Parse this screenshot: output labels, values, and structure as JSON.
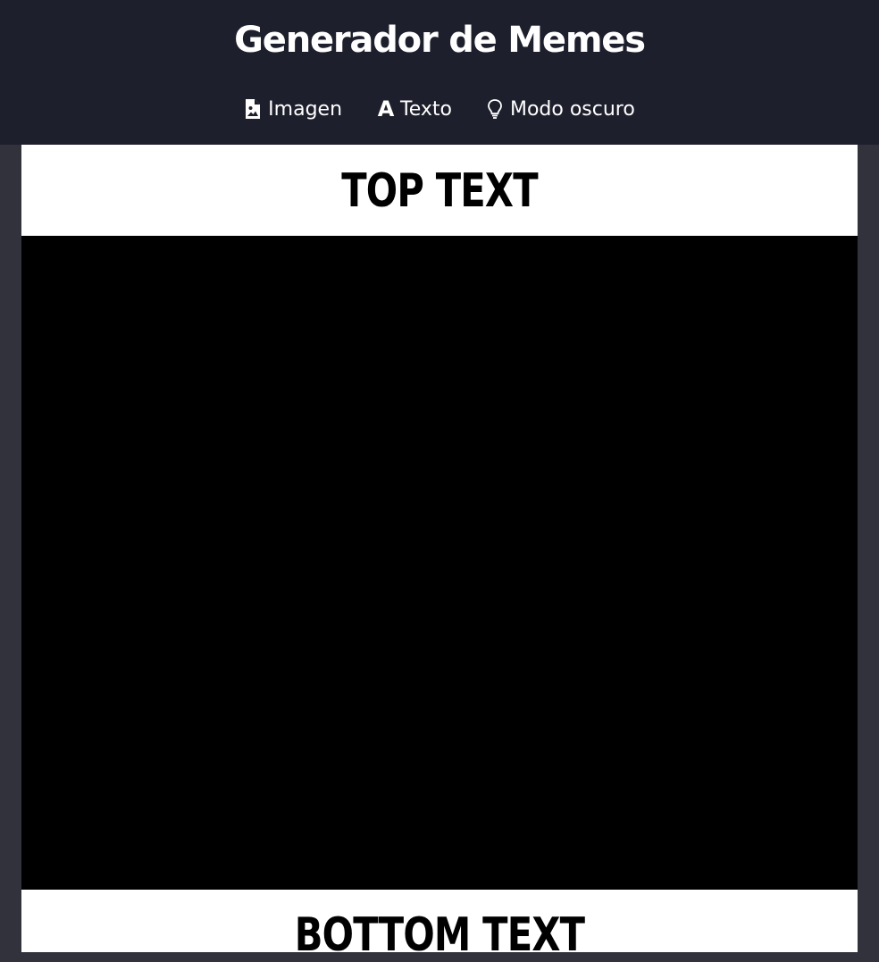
{
  "header": {
    "title": "Generador de Memes",
    "nav": [
      {
        "label": "Imagen",
        "icon": "image-file-icon"
      },
      {
        "label": "Texto",
        "icon": "text-icon"
      },
      {
        "label": "Modo oscuro",
        "icon": "lightbulb-icon"
      }
    ]
  },
  "meme": {
    "top_text": "TOP TEXT",
    "bottom_text": "BOTTOM TEXT",
    "image_background": "#000000"
  },
  "colors": {
    "header_bg": "#1d1f2c",
    "page_bg": "#32323d",
    "meme_bg": "#ffffff",
    "text": "#ffffff"
  }
}
